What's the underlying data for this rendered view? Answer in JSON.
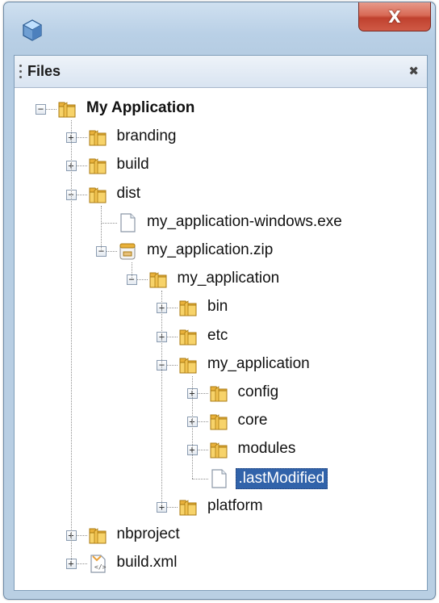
{
  "panel": {
    "title": "Files",
    "close_glyph": "✖"
  },
  "window": {
    "close_glyph": "X",
    "icon": "netbeans-cube-icon"
  },
  "tree": [
    {
      "id": "root",
      "label": "My Application",
      "icon": "folder",
      "expander": "minus",
      "bold": true
    },
    {
      "id": "branding",
      "label": "branding",
      "icon": "folder",
      "expander": "plus"
    },
    {
      "id": "build",
      "label": "build",
      "icon": "folder",
      "expander": "plus"
    },
    {
      "id": "dist",
      "label": "dist",
      "icon": "folder",
      "expander": "minus"
    },
    {
      "id": "exe",
      "label": "my_application-windows.exe",
      "icon": "file",
      "expander": null
    },
    {
      "id": "zip",
      "label": "my_application.zip",
      "icon": "zip",
      "expander": "minus"
    },
    {
      "id": "myapp1",
      "label": "my_application",
      "icon": "folder",
      "expander": "minus"
    },
    {
      "id": "bin",
      "label": "bin",
      "icon": "folder",
      "expander": "plus"
    },
    {
      "id": "etc",
      "label": "etc",
      "icon": "folder",
      "expander": "plus"
    },
    {
      "id": "myapp2",
      "label": "my_application",
      "icon": "folder",
      "expander": "minus"
    },
    {
      "id": "config",
      "label": "config",
      "icon": "folder",
      "expander": "plus"
    },
    {
      "id": "core",
      "label": "core",
      "icon": "folder",
      "expander": "plus"
    },
    {
      "id": "modules",
      "label": "modules",
      "icon": "folder",
      "expander": "plus"
    },
    {
      "id": "lastmod",
      "label": ".lastModified",
      "icon": "file",
      "expander": null,
      "selected": true
    },
    {
      "id": "platform",
      "label": "platform",
      "icon": "folder",
      "expander": "plus"
    },
    {
      "id": "nbproject",
      "label": "nbproject",
      "icon": "folder",
      "expander": "plus"
    },
    {
      "id": "buildxml",
      "label": "build.xml",
      "icon": "xml-file",
      "expander": "plus"
    }
  ],
  "colors": {
    "selection": "#3163aa",
    "folder": "#f2c14e",
    "close_button": "#c0412e"
  }
}
